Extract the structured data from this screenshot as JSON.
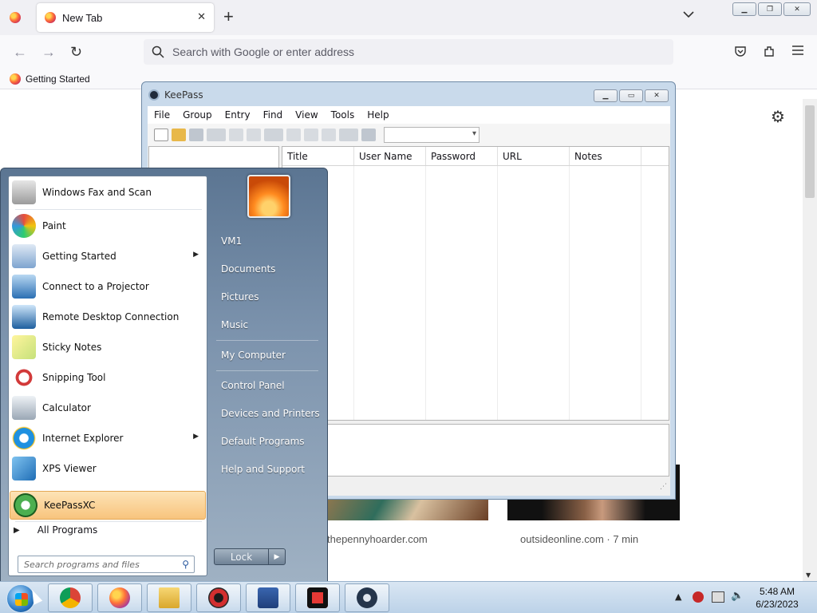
{
  "firefox": {
    "tab_title": "New Tab",
    "url_placeholder": "Search with Google or enter address",
    "bookmark": "Getting Started",
    "cards": [
      {
        "source": "thepennyhoarder.com"
      },
      {
        "source": "outsideonline.com · 7 min"
      }
    ]
  },
  "keepass": {
    "title": "KeePass",
    "menu": [
      "File",
      "Group",
      "Entry",
      "Find",
      "View",
      "Tools",
      "Help"
    ],
    "columns": [
      "Title",
      "User Name",
      "Password",
      "URL",
      "Notes"
    ]
  },
  "start_menu": {
    "programs": [
      {
        "label": "Windows Fax and Scan",
        "submenu": false
      },
      {
        "label": "Paint",
        "submenu": false
      },
      {
        "label": "Getting Started",
        "submenu": true
      },
      {
        "label": "Connect to a Projector",
        "submenu": false
      },
      {
        "label": "Remote Desktop Connection",
        "submenu": false
      },
      {
        "label": "Sticky Notes",
        "submenu": false
      },
      {
        "label": "Snipping Tool",
        "submenu": false
      },
      {
        "label": "Calculator",
        "submenu": false
      },
      {
        "label": "Internet Explorer",
        "submenu": true
      },
      {
        "label": "XPS Viewer",
        "submenu": false
      },
      {
        "label": "KeePassXC",
        "submenu": false,
        "highlighted": true
      }
    ],
    "all_programs": "All Programs",
    "search_placeholder": "Search programs and files",
    "right_links": [
      "VM1",
      "Documents",
      "Pictures",
      "Music",
      "My Computer",
      "Control Panel",
      "Devices and Printers",
      "Default Programs",
      "Help and Support"
    ],
    "lock_label": "Lock"
  },
  "taskbar": {
    "apps": [
      "chrome-icon",
      "firefox-icon",
      "file-explorer-icon",
      "app-red-icon",
      "app-blue-icon",
      "screen-recorder-icon",
      "keepassxc-icon"
    ],
    "time": "5:48 AM",
    "date": "6/23/2023"
  }
}
